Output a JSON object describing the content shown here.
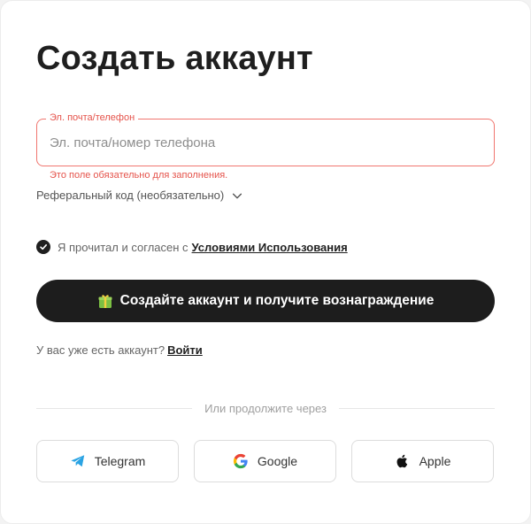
{
  "title": "Создать аккаунт",
  "field": {
    "legend": "Эл. почта/телефон",
    "placeholder": "Эл. почта/номер телефона",
    "value": "",
    "error": "Это поле обязательно для заполнения."
  },
  "referral": {
    "label": "Реферальный код (необязательно)",
    "icon": "chevron-down-icon"
  },
  "terms": {
    "checked": true,
    "text": "Я прочитал и согласен с",
    "link": "Условиями Использования"
  },
  "primary": {
    "label": "Создайте аккаунт и получите вознаграждение",
    "icon": "gift-icon"
  },
  "login": {
    "text": "У вас уже есть аккаунт?",
    "link": "Войти"
  },
  "divider": {
    "text": "Или продолжите через"
  },
  "social": [
    {
      "label": "Telegram",
      "icon": "telegram-icon"
    },
    {
      "label": "Google",
      "icon": "google-icon"
    },
    {
      "label": "Apple",
      "icon": "apple-icon"
    }
  ],
  "colors": {
    "error": "#e5534b",
    "primary_bg": "#1d1d1d",
    "text": "#1f1f1f"
  }
}
